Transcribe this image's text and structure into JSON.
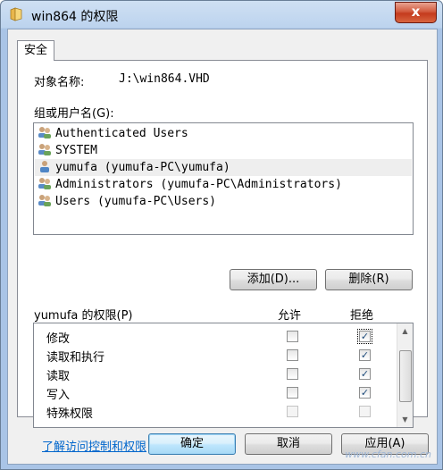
{
  "window": {
    "title": "win864 的权限",
    "close_glyph": "x"
  },
  "tabs": [
    {
      "label": "安全"
    }
  ],
  "object": {
    "label": "对象名称:",
    "value": "J:\\win864.VHD"
  },
  "groups": {
    "label": "组或用户名(G):",
    "items": [
      {
        "label": "Authenticated Users",
        "icon": "group-icon"
      },
      {
        "label": "SYSTEM",
        "icon": "group-icon"
      },
      {
        "label": "yumufa (yumufa-PC\\yumufa)",
        "icon": "user-icon",
        "selected": true
      },
      {
        "label": "Administrators (yumufa-PC\\Administrators)",
        "icon": "group-icon"
      },
      {
        "label": "Users (yumufa-PC\\Users)",
        "icon": "group-icon"
      }
    ]
  },
  "buttons": {
    "add": "添加(D)...",
    "remove": "删除(R)",
    "ok": "确定",
    "cancel": "取消",
    "apply": "应用(A)"
  },
  "permissions": {
    "label": "yumufa 的权限(P)",
    "allow_header": "允许",
    "deny_header": "拒绝",
    "rows": [
      {
        "name": "修改",
        "allow": false,
        "deny": true
      },
      {
        "name": "读取和执行",
        "allow": false,
        "deny": true
      },
      {
        "name": "读取",
        "allow": false,
        "deny": true
      },
      {
        "name": "写入",
        "allow": false,
        "deny": true
      },
      {
        "name": "特殊权限",
        "allow": false,
        "deny": false
      }
    ]
  },
  "link": "了解访问控制和权限",
  "watermark": "www.cfan.com.cn"
}
